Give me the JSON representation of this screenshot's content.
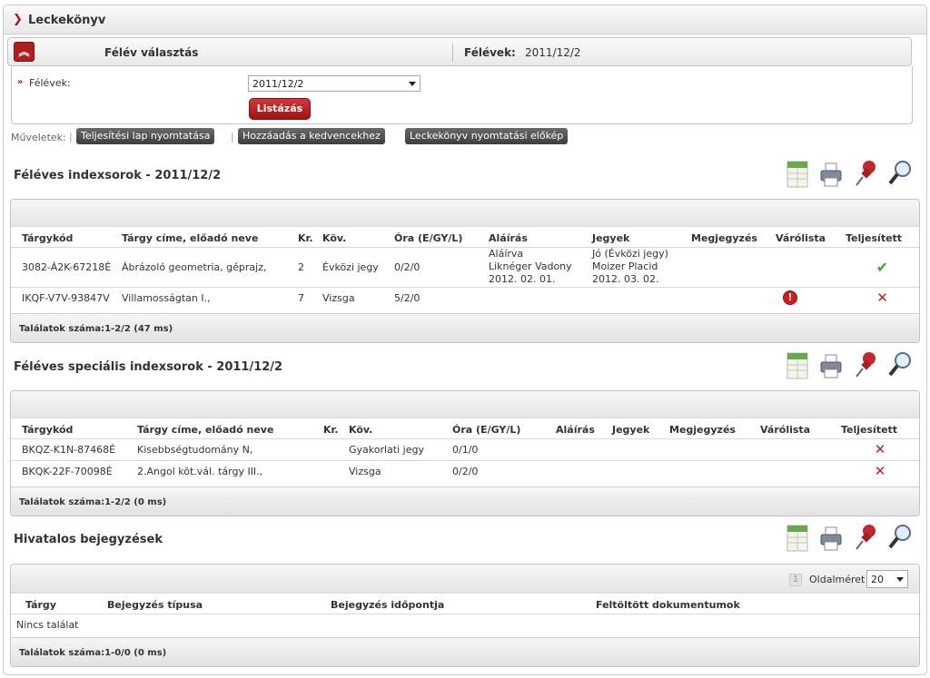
{
  "app": {
    "title": "Leckekönyv"
  },
  "semester": {
    "section_title": "Félév választás",
    "current_label": "Félévek:",
    "current_value": "2011/12/2",
    "field_label": "Félévek:",
    "selected": "2011/12/2",
    "list_button": "Listázás"
  },
  "operations": {
    "label": "Műveletek:",
    "buttons": [
      "Teljesítési lap nyomtatása",
      "Hozzáadás a kedvencekhez",
      "Leckekönyv nyomtatási előkép"
    ]
  },
  "tool_icons": [
    "xls-export-icon",
    "print-icon",
    "pin-icon",
    "magnifier-icon"
  ],
  "index_rows": {
    "title": "Féléves indexsorok - 2011/12/2",
    "columns": [
      "Tárgykód",
      "Tárgy címe, előadó neve",
      "Kr.",
      "Köv.",
      "Óra (E/GY/L)",
      "Aláírás",
      "Jegyek",
      "Megjegyzés",
      "Várólista",
      "Teljesített"
    ],
    "rows": [
      {
        "code": "3082-Á2K-67218É",
        "name": "Ábrázoló geometria, géprajz,",
        "credits": "2",
        "requirement": "Évközi jegy",
        "hours": "0/2/0",
        "signature": [
          "Aláírva",
          "Liknéger Vadony",
          "2012. 02. 01."
        ],
        "grades": [
          "Jó (Évközi jegy)",
          "Moizer Placid",
          "2012. 03. 02."
        ],
        "note": "",
        "waitlist": "",
        "completed": "check"
      },
      {
        "code": "IKQF-V7V-93847V",
        "name": "Villamosságtan I.,",
        "credits": "7",
        "requirement": "Vizsga",
        "hours": "5/2/0",
        "signature": [],
        "grades": [],
        "note": "",
        "waitlist": "alert",
        "completed": "cross"
      }
    ],
    "footer": "Találatok száma:1-2/2 (47 ms)"
  },
  "special_rows": {
    "title": "Féléves speciális indexsorok - 2011/12/2",
    "columns": [
      "Tárgykód",
      "Tárgy címe, előadó neve",
      "Kr.",
      "Köv.",
      "Óra (E/GY/L)",
      "Aláírás",
      "Jegyek",
      "Megjegyzés",
      "Várólista",
      "Teljesített"
    ],
    "rows": [
      {
        "code": "BKQZ-K1N-87468É",
        "name": "Kisebbségtudomány N,",
        "credits": "",
        "requirement": "Gyakorlati jegy",
        "hours": "0/1/0",
        "completed": "cross"
      },
      {
        "code": "BKQK-22F-70098É",
        "name": "2.Angol köt.vál. tárgy III.,",
        "credits": "",
        "requirement": "Vizsga",
        "hours": "0/2/0",
        "completed": "cross"
      }
    ],
    "footer": "Találatok száma:1-2/2 (0 ms)"
  },
  "official": {
    "title": "Hivatalos bejegyzések",
    "page_number": "1",
    "page_size_label": "Oldalméret",
    "page_size": "20",
    "columns": [
      "Tárgy",
      "Bejegyzés típusa",
      "Bejegyzés időpontja",
      "Feltöltött dokumentumok"
    ],
    "empty_text": "Nincs találat",
    "footer": "Találatok száma:1-0/0 (0 ms)"
  }
}
